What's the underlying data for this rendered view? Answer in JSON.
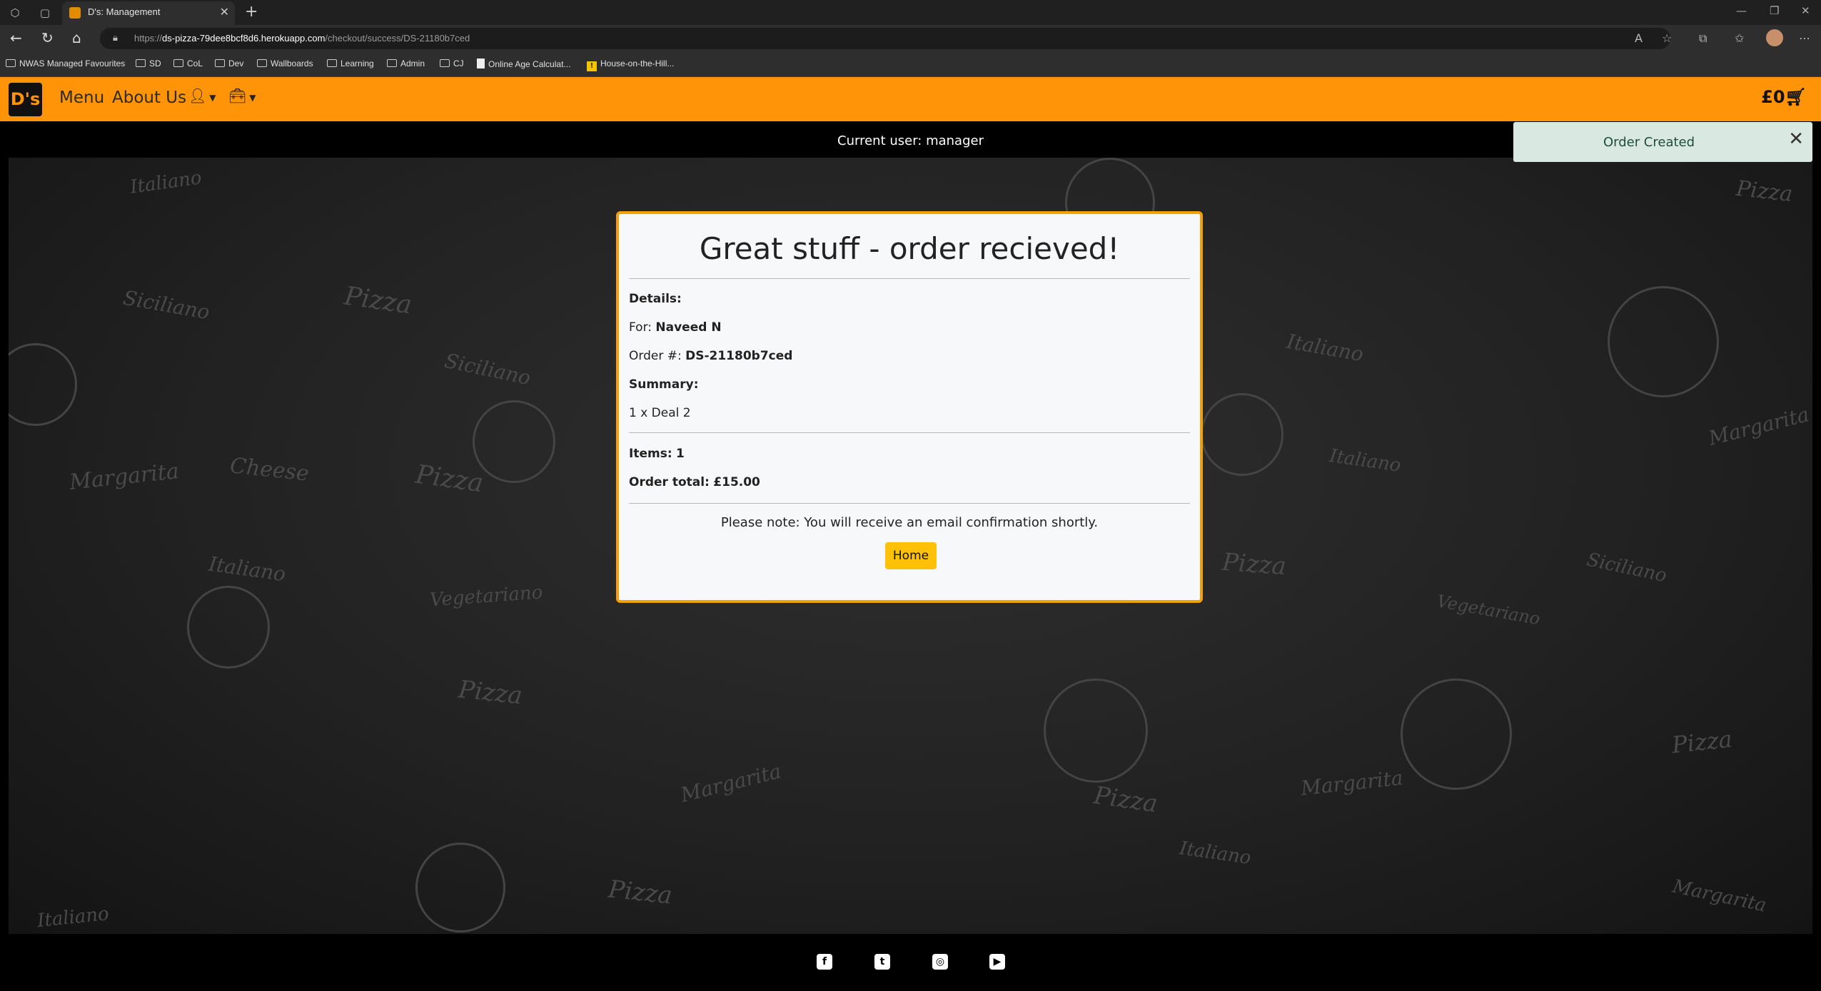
{
  "browser": {
    "tab_title": "D's: Management",
    "url_prefix": "https://",
    "url_host": "ds-pizza-79dee8bcf8d6.herokuapp.com",
    "url_path": "/checkout/success/DS-21180b7ced",
    "bookmarks": [
      "NWAS Managed Favourites",
      "SD",
      "CoL",
      "Dev",
      "Wallboards",
      "Learning",
      "Admin",
      "CJ",
      "Online Age Calculat...",
      "House-on-the-Hill..."
    ]
  },
  "navbar": {
    "logo": "D's",
    "links": [
      "Menu",
      "About Us"
    ],
    "cart_total": "£0"
  },
  "userbar": {
    "text": "Current user: manager"
  },
  "toast": {
    "message": "Order Created"
  },
  "order": {
    "title": "Great stuff - order recieved!",
    "details_label": "Details:",
    "for_label": "For:",
    "customer": "Naveed N",
    "order_label": "Order #:",
    "order_number": "DS-21180b7ced",
    "summary_label": "Summary:",
    "summary_item": "1 x Deal 2",
    "items_label": "Items:",
    "items_count": "1",
    "total_label": "Order total:",
    "total": "£15.00",
    "note": "Please note: You will receive an email confirmation shortly.",
    "home_button": "Home"
  },
  "background_words": [
    "Italiano",
    "Siciliano",
    "Pizza",
    "Margarita",
    "Cheese",
    "Vegetariano"
  ],
  "colors": {
    "brand_orange": "#ff9408",
    "button_yellow": "#ffc107",
    "toast_bg": "#d9e9e2"
  }
}
